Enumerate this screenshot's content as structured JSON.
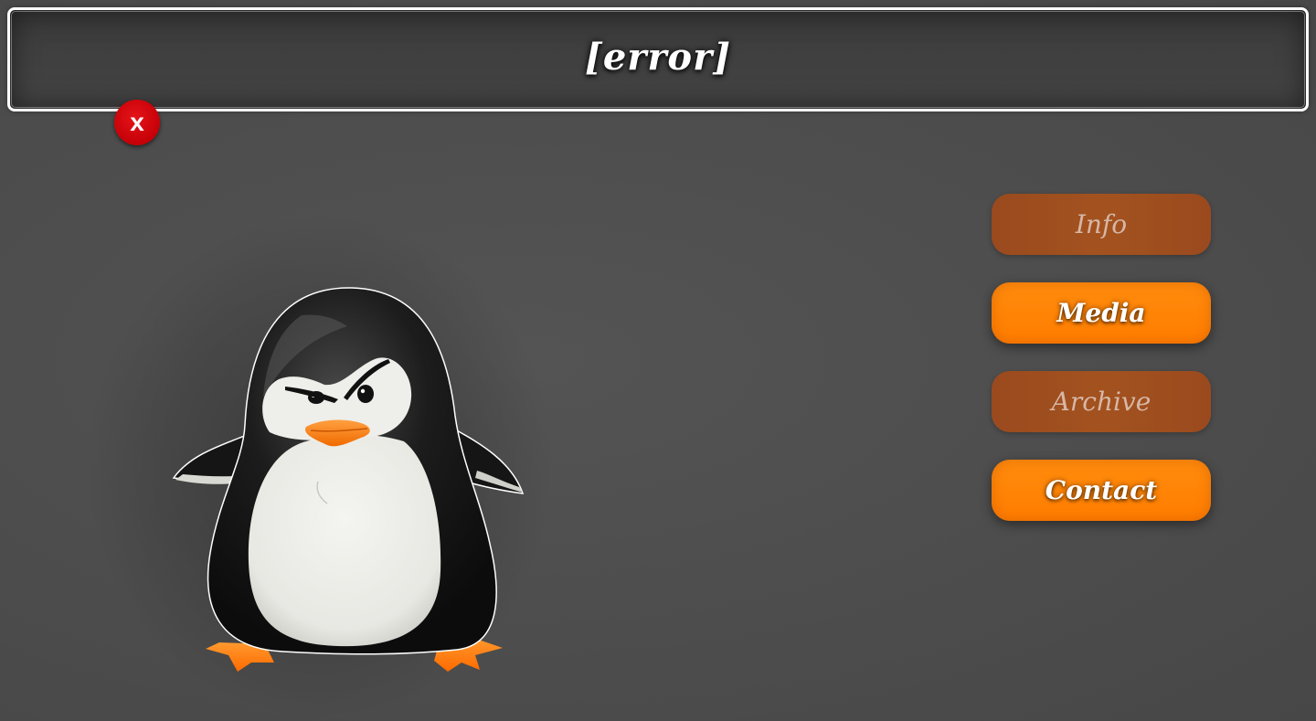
{
  "header": {
    "title": "[error]"
  },
  "close_button": {
    "label": "x"
  },
  "nav": {
    "items": [
      {
        "label": "Info",
        "state": "dim"
      },
      {
        "label": "Media",
        "state": "bright"
      },
      {
        "label": "Archive",
        "state": "dim"
      },
      {
        "label": "Contact",
        "state": "bright"
      }
    ]
  },
  "colors": {
    "background": "#4d4d4d",
    "accent_orange": "#ff8200",
    "muted_orange": "#a04f1f",
    "close_red": "#d3000a"
  },
  "icons": {
    "close": "close-icon",
    "mascot": "penguin-mascot"
  }
}
